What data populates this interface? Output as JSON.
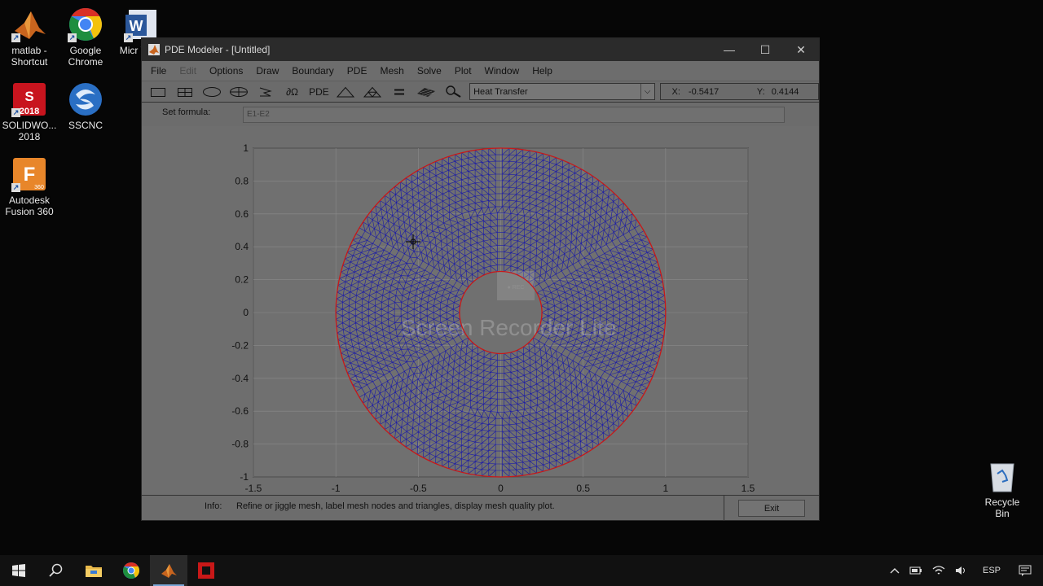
{
  "desktop_icons": [
    {
      "label": "matlab - Shortcut"
    },
    {
      "label": "Google Chrome"
    },
    {
      "label": "Micr Word"
    },
    {
      "label": "SOLIDWO... 2018"
    },
    {
      "label": "SSCNC"
    },
    {
      "label": "Autodesk Fusion 360"
    }
  ],
  "desktop_icon_badges": {
    "solidworks": "2018",
    "fusion": "360"
  },
  "window": {
    "title": "PDE Modeler - [Untitled]",
    "minimize": "—",
    "maximize": "☐",
    "close": "✕"
  },
  "menu": [
    "File",
    "Edit",
    "Options",
    "Draw",
    "Boundary",
    "PDE",
    "Mesh",
    "Solve",
    "Plot",
    "Window",
    "Help"
  ],
  "toolbar": {
    "boundary_label": "∂Ω",
    "pde_label": "PDE",
    "app_mode": "Heat Transfer",
    "x_label": "X:",
    "x_value": "-0.5417",
    "y_label": "Y:",
    "y_value": "0.4144"
  },
  "formula": {
    "label": "Set formula:",
    "value": "E1-E2"
  },
  "info": {
    "label": "Info:",
    "text": "Refine or jiggle mesh, label mesh nodes and triangles, display mesh quality plot.",
    "exit_label": "Exit"
  },
  "plot": {
    "xticks": [
      "-1.5",
      "-1",
      "-0.5",
      "0",
      "0.5",
      "1",
      "1.5"
    ],
    "yticks": [
      "1",
      "0.8",
      "0.6",
      "0.4",
      "0.2",
      "0",
      "-0.2",
      "-0.4",
      "-0.6",
      "-0.8",
      "-1"
    ],
    "xlim": [
      -1.5,
      1.5
    ],
    "ylim": [
      -1,
      1
    ],
    "outer_radius": 1,
    "inner_radius": 0.25,
    "mesh_color": "#1a1aa8",
    "boundary_color": "#c81818",
    "grid": true
  },
  "watermark": {
    "badge": "● REC",
    "text": "Screen Recorder Lite"
  },
  "recycle_bin": {
    "label": "Recycle Bin"
  },
  "tray": {
    "language": "ESP"
  },
  "colors": {
    "chrome_red": "#d93025",
    "chrome_yellow": "#f4c20d",
    "chrome_green": "#1e8e3e",
    "chrome_blue": "#4285f4"
  }
}
